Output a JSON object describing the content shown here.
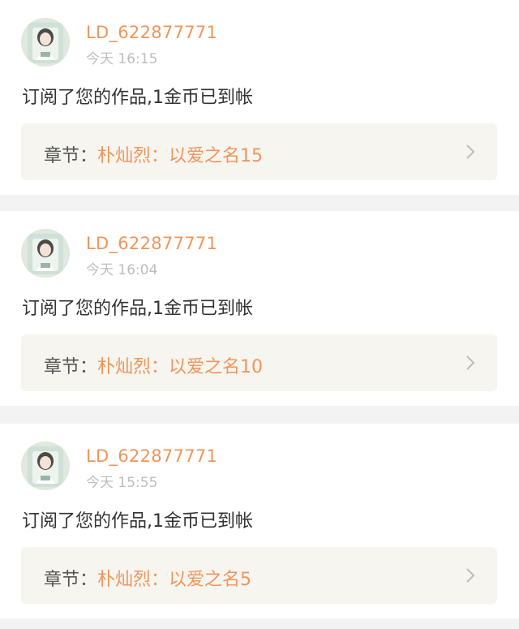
{
  "notifications": [
    {
      "username": "LD_622877771",
      "time": "今天 16:15",
      "message": "订阅了您的作品,1金币已到帐",
      "chapter_prefix": "章节：",
      "chapter_title": "朴灿烈：以爱之名15"
    },
    {
      "username": "LD_622877771",
      "time": "今天 16:04",
      "message": "订阅了您的作品,1金币已到帐",
      "chapter_prefix": "章节：",
      "chapter_title": "朴灿烈：以爱之名10"
    },
    {
      "username": "LD_622877771",
      "time": "今天 15:55",
      "message": "订阅了您的作品,1金币已到帐",
      "chapter_prefix": "章节：",
      "chapter_title": "朴灿烈：以爱之名5"
    }
  ],
  "icons": {
    "chevron": "chevron-right-icon",
    "avatar": "avatar"
  },
  "colors": {
    "accent": "#f0955a",
    "muted": "#bdbdbd",
    "text": "#333333",
    "chapter_bg": "#f6f5f0",
    "page_bg": "#f3f3f3"
  }
}
